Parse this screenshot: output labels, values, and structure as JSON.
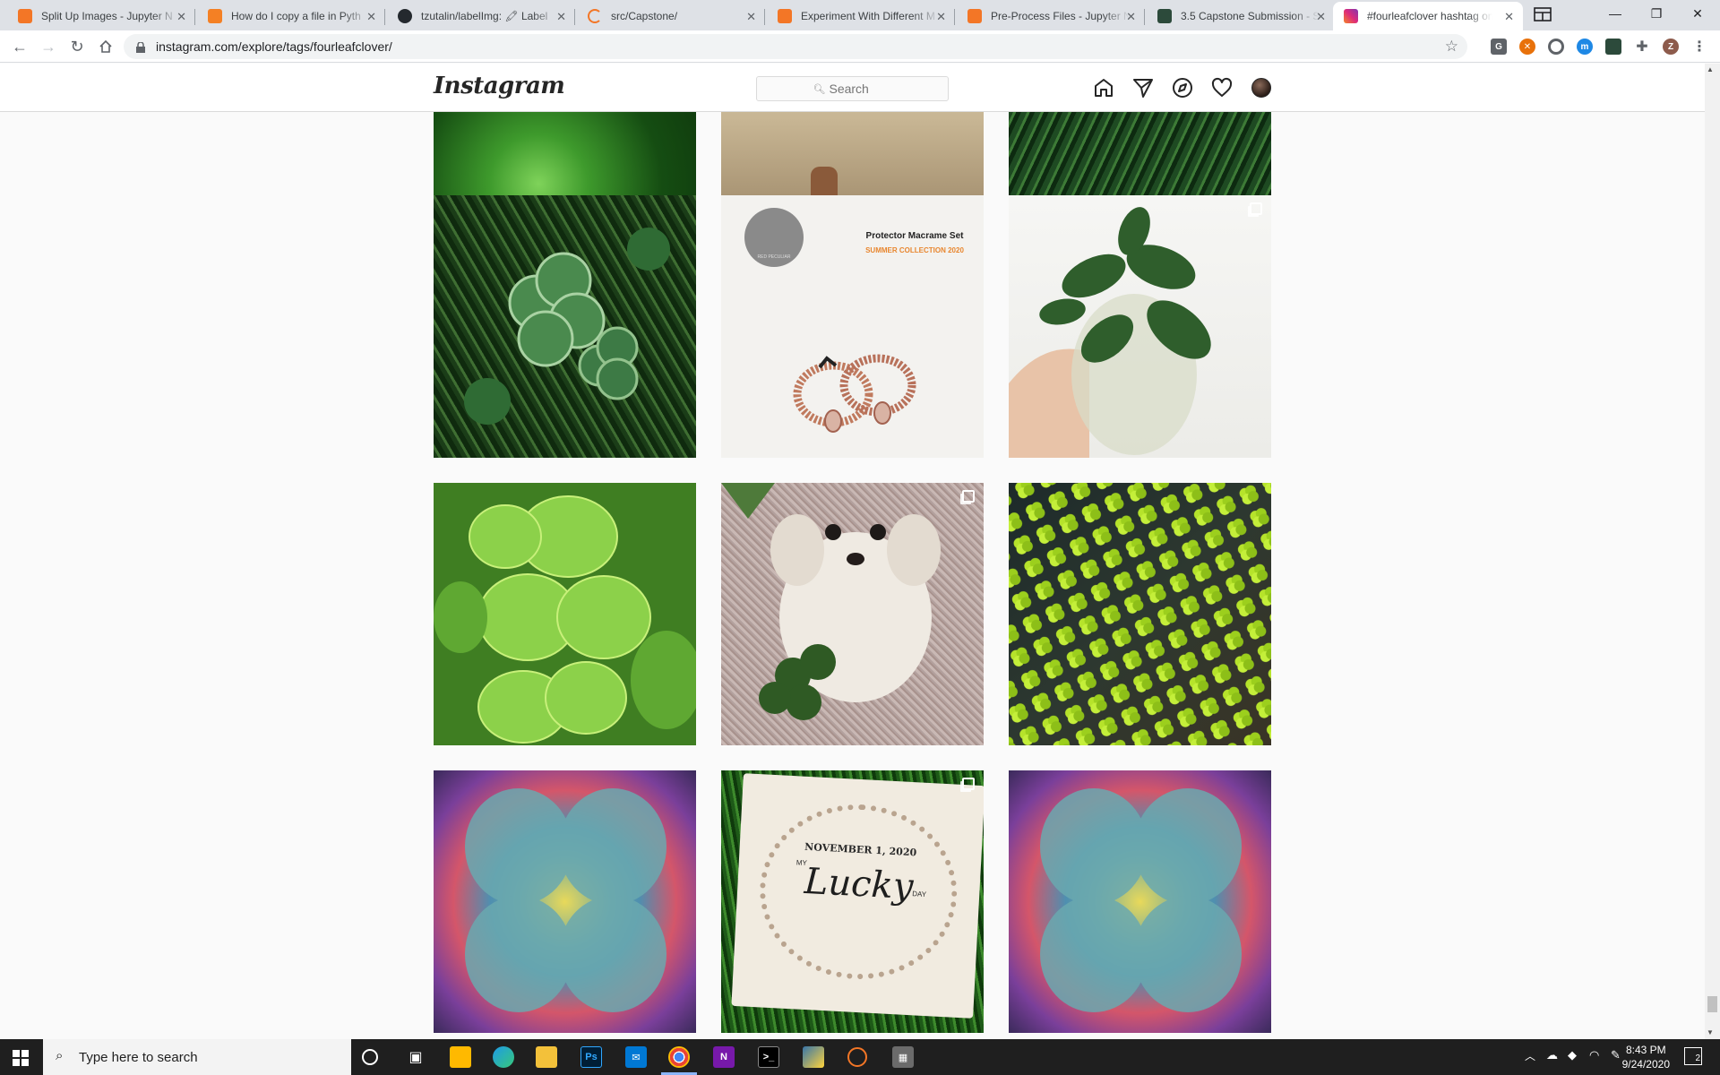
{
  "browser": {
    "tabs": [
      {
        "title": "Split Up Images - Jupyter N",
        "favicon": "jupyter-icon",
        "color": "#f37626"
      },
      {
        "title": "How do I copy a file in Pyth",
        "favicon": "stackoverflow-icon",
        "color": "#f48024"
      },
      {
        "title": "tzutalin/labelImg: 🖍 Label",
        "favicon": "github-icon",
        "color": "#24292e"
      },
      {
        "title": "src/Capstone/",
        "favicon": "loading-icon",
        "color": "#f37626"
      },
      {
        "title": "Experiment With Different M",
        "favicon": "jupyter-icon",
        "color": "#f37626"
      },
      {
        "title": "Pre-Process Files - Jupyter N",
        "favicon": "jupyter-icon",
        "color": "#f37626"
      },
      {
        "title": "3.5 Capstone Submission - S",
        "favicon": "springboard-icon",
        "color": "#2c4a3b"
      },
      {
        "title": "#fourleafclover hashtag on I",
        "favicon": "instagram-icon",
        "color": "#c13584",
        "active": true
      }
    ],
    "url": "instagram.com/explore/tags/fourleafclover/",
    "profile_initial": "Z"
  },
  "instagram": {
    "logo": "Instagram",
    "search_placeholder": "Search",
    "nav_icons": [
      "home-icon",
      "direct-icon",
      "explore-icon",
      "activity-heart-icon",
      "profile-avatar"
    ]
  },
  "posts": {
    "row2_middle": {
      "title": "Protector Macrame Set",
      "subtitle": "SUMMER COLLECTION 2020",
      "brand": "RED PECULIAR"
    },
    "row4_middle": {
      "date": "NOVEMBER 1, 2020",
      "word_my": "MY",
      "word_lucky": "Lucky",
      "word_day": "DAY"
    }
  },
  "taskbar": {
    "search_placeholder": "Type here to search",
    "time": "8:43 PM",
    "date": "9/24/2020",
    "notifications": "2"
  }
}
